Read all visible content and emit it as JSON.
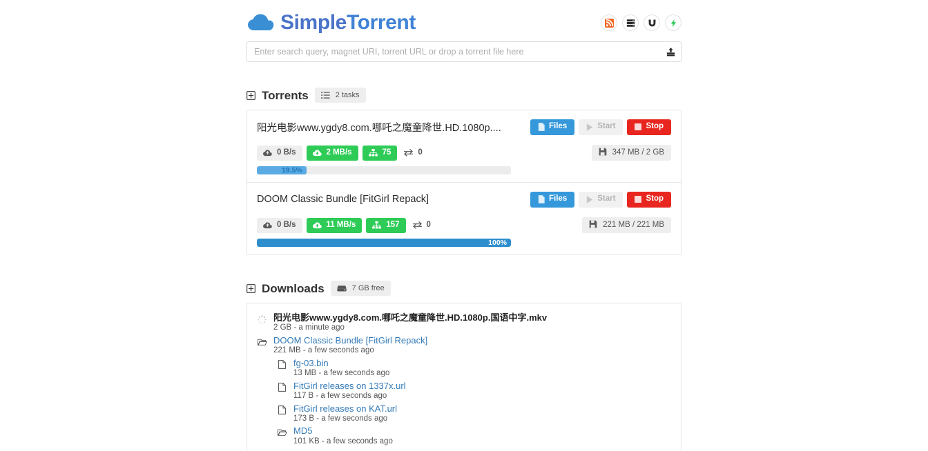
{
  "app": {
    "brand_primary": "Simple",
    "brand_secondary": "Torrent",
    "colors": {
      "blue": "#3498db",
      "green": "#2ecc57",
      "red": "#e8261f",
      "orange": "#f26522",
      "gray_badge": "#eeeeee",
      "link": "#337ab7",
      "progress_track": "#ececec"
    }
  },
  "header": {
    "icons": [
      {
        "name": "rss-icon",
        "title": "RSS"
      },
      {
        "name": "server-icon",
        "title": "Server"
      },
      {
        "name": "magnet-icon",
        "title": "Magnet"
      },
      {
        "name": "bolt-icon",
        "title": "Activity"
      }
    ]
  },
  "search": {
    "placeholder": "Enter search query, magnet URI, torrent URL or drop a torrent file here",
    "value": "",
    "upload_icon": "upload-icon"
  },
  "torrents_section": {
    "title": "Torrents",
    "badge_label": "2 tasks",
    "badge_icon": "list-icon",
    "toggle_icon": "plus-square-icon"
  },
  "torrents": [
    {
      "name": "阳光电影www.ygdy8.com.哪吒之魔童降世.HD.1080p....",
      "buttons": {
        "files": "Files",
        "start": "Start",
        "stop": "Stop"
      },
      "upload_rate": "0 B/s",
      "download_rate": "2 MB/s",
      "peers": "75",
      "swarm": "0",
      "size": "347 MB / 2 GB",
      "progress_label": "19.5%",
      "progress_percent": 19.5,
      "fill_color": "#5aabe3",
      "text_color": "#1b6fb5"
    },
    {
      "name": "DOOM Classic Bundle [FitGirl Repack]",
      "buttons": {
        "files": "Files",
        "start": "Start",
        "stop": "Stop"
      },
      "upload_rate": "0 B/s",
      "download_rate": "11 MB/s",
      "peers": "157",
      "swarm": "0",
      "size": "221 MB / 221 MB",
      "progress_label": "100%",
      "progress_percent": 100,
      "fill_color": "#2e8ecd",
      "text_color": "#ffffff"
    }
  ],
  "downloads_section": {
    "title": "Downloads",
    "badge_label": "7 GB free",
    "badge_icon": "hdd-icon",
    "toggle_icon": "plus-square-icon"
  },
  "downloads": [
    {
      "icon": "spinner-icon",
      "name": "阳光电影www.ygdy8.com.哪吒之魔童降世.HD.1080p.国语中字.mkv",
      "meta": "2 GB - a minute ago",
      "is_link": false,
      "indent": 0
    },
    {
      "icon": "folder-open-icon",
      "name": "DOOM Classic Bundle [FitGirl Repack]",
      "meta": "221 MB - a few seconds ago",
      "is_link": true,
      "indent": 0
    },
    {
      "icon": "file-icon",
      "name": "fg-03.bin",
      "meta": "13 MB - a few seconds ago",
      "is_link": true,
      "indent": 1
    },
    {
      "icon": "file-icon",
      "name": "FitGirl releases on 1337x.url",
      "meta": "117 B - a few seconds ago",
      "is_link": true,
      "indent": 1
    },
    {
      "icon": "file-icon",
      "name": "FitGirl releases on KAT.url",
      "meta": "173 B - a few seconds ago",
      "is_link": true,
      "indent": 1
    },
    {
      "icon": "folder-open-icon",
      "name": "MD5",
      "meta": "101 KB - a few seconds ago",
      "is_link": true,
      "indent": 1
    }
  ]
}
